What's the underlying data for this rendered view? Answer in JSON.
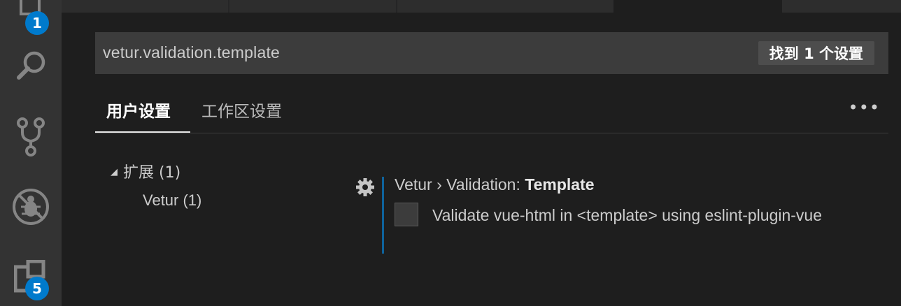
{
  "activity_bar": {
    "explorer_badge": "1",
    "extensions_badge": "5"
  },
  "search": {
    "value": "vetur.validation.template",
    "result_count": "找到 1 个设置"
  },
  "tabs": {
    "user": "用户设置",
    "workspace": "工作区设置",
    "more": "•••"
  },
  "toc": {
    "extensions": "扩展 (1)",
    "vetur": "Vetur (1)"
  },
  "setting": {
    "category": "Vetur › Validation: ",
    "name": "Template",
    "description": "Validate vue-html in <template> using eslint-plugin-vue",
    "checked": false
  },
  "colors": {
    "accent": "#007acc",
    "setting_bar": "#0e639c"
  }
}
